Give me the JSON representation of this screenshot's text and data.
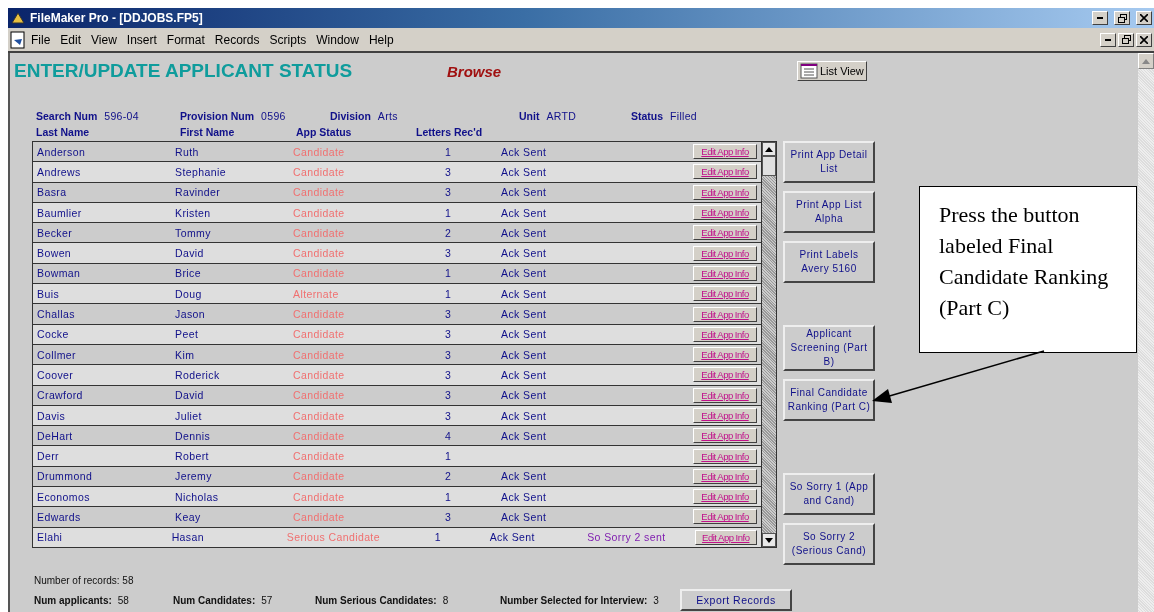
{
  "window": {
    "title": "FileMaker Pro - [DDJOBS.FP5]"
  },
  "menu": [
    "File",
    "Edit",
    "View",
    "Insert",
    "Format",
    "Records",
    "Scripts",
    "Window",
    "Help"
  ],
  "layout": {
    "title": "ENTER/UPDATE APPLICANT STATUS",
    "mode": "Browse",
    "view_button": "List View"
  },
  "fields": [
    {
      "label": "Search Num",
      "value": "596-04"
    },
    {
      "label": "Provision Num",
      "value": "0596"
    },
    {
      "label": "Division",
      "value": "Arts"
    },
    {
      "label": "Unit",
      "value": "ARTD"
    },
    {
      "label": "Status",
      "value": "Filled"
    }
  ],
  "columns": [
    "Last Name",
    "First Name",
    "App Status",
    "Letters Rec'd"
  ],
  "rows": [
    {
      "last_name": "Anderson",
      "first_name": "Ruth",
      "app_status": "Candidate",
      "letters": "1",
      "ack": "Ack Sent",
      "edit": "Edit App Info"
    },
    {
      "last_name": "Andrews",
      "first_name": "Stephanie",
      "app_status": "Candidate",
      "letters": "3",
      "ack": "Ack Sent",
      "edit": "Edit App Info"
    },
    {
      "last_name": "Basra",
      "first_name": "Ravinder",
      "app_status": "Candidate",
      "letters": "3",
      "ack": "Ack Sent",
      "edit": "Edit App Info"
    },
    {
      "last_name": "Baumlier",
      "first_name": "Kristen",
      "app_status": "Candidate",
      "letters": "1",
      "ack": "Ack Sent",
      "edit": "Edit App Info"
    },
    {
      "last_name": "Becker",
      "first_name": "Tommy",
      "app_status": "Candidate",
      "letters": "2",
      "ack": "Ack Sent",
      "edit": "Edit App Info"
    },
    {
      "last_name": "Bowen",
      "first_name": "David",
      "app_status": "Candidate",
      "letters": "3",
      "ack": "Ack Sent",
      "edit": "Edit App Info"
    },
    {
      "last_name": "Bowman",
      "first_name": "Brice",
      "app_status": "Candidate",
      "letters": "1",
      "ack": "Ack Sent",
      "edit": "Edit App Info"
    },
    {
      "last_name": "Buis",
      "first_name": "Doug",
      "app_status": "Alternate",
      "letters": "1",
      "ack": "Ack Sent",
      "edit": "Edit App Info"
    },
    {
      "last_name": "Challas",
      "first_name": "Jason",
      "app_status": "Candidate",
      "letters": "3",
      "ack": "Ack Sent",
      "edit": "Edit App Info"
    },
    {
      "last_name": "Cocke",
      "first_name": "Peet",
      "app_status": "Candidate",
      "letters": "3",
      "ack": "Ack Sent",
      "edit": "Edit App Info"
    },
    {
      "last_name": "Collmer",
      "first_name": "Kim",
      "app_status": "Candidate",
      "letters": "3",
      "ack": "Ack Sent",
      "edit": "Edit App Info"
    },
    {
      "last_name": "Coover",
      "first_name": "Roderick",
      "app_status": "Candidate",
      "letters": "3",
      "ack": "Ack Sent",
      "edit": "Edit App Info"
    },
    {
      "last_name": "Crawford",
      "first_name": "David",
      "app_status": "Candidate",
      "letters": "3",
      "ack": "Ack Sent",
      "edit": "Edit App Info"
    },
    {
      "last_name": "Davis",
      "first_name": "Juliet",
      "app_status": "Candidate",
      "letters": "3",
      "ack": "Ack Sent",
      "edit": "Edit App Info"
    },
    {
      "last_name": "DeHart",
      "first_name": "Dennis",
      "app_status": "Candidate",
      "letters": "4",
      "ack": "Ack Sent",
      "edit": "Edit App Info"
    },
    {
      "last_name": "Derr",
      "first_name": "Robert",
      "app_status": "Candidate",
      "letters": "1",
      "edit": "Edit App Info"
    },
    {
      "last_name": "Drummond",
      "first_name": "Jeremy",
      "app_status": "Candidate",
      "letters": "2",
      "ack": "Ack Sent",
      "edit": "Edit App Info"
    },
    {
      "last_name": "Economos",
      "first_name": "Nicholas",
      "app_status": "Candidate",
      "letters": "1",
      "ack": "Ack Sent",
      "edit": "Edit App Info"
    },
    {
      "last_name": "Edwards",
      "first_name": "Keay",
      "app_status": "Candidate",
      "letters": "3",
      "ack": "Ack Sent",
      "edit": "Edit App Info"
    },
    {
      "last_name": "Elahi",
      "first_name": "Hasan",
      "app_status": "Serious Candidate",
      "letters": "1",
      "ack": "Ack Sent",
      "note": "So Sorry 2 sent",
      "edit": "Edit App Info"
    }
  ],
  "side_buttons": [
    "Print App Detail List",
    "Print App List Alpha",
    "Print Labels Avery 5160",
    "Applicant Screening (Part B)",
    "Final Candidate Ranking (Part C)",
    "So Sorry 1 (App and Cand)",
    "So Sorry 2 (Serious Cand)"
  ],
  "footer": {
    "records": "Number of records: 58",
    "stats": [
      {
        "label": "Num applicants:",
        "value": "58"
      },
      {
        "label": "Num Candidates:",
        "value": "57"
      },
      {
        "label": "Num Serious Candidates:",
        "value": "8"
      },
      {
        "label": "Number Selected for Interview:",
        "value": "3"
      }
    ],
    "export_button": "Export Records"
  },
  "callout": {
    "text": "Press the button labeled Final Candidate Ranking (Part C)"
  }
}
